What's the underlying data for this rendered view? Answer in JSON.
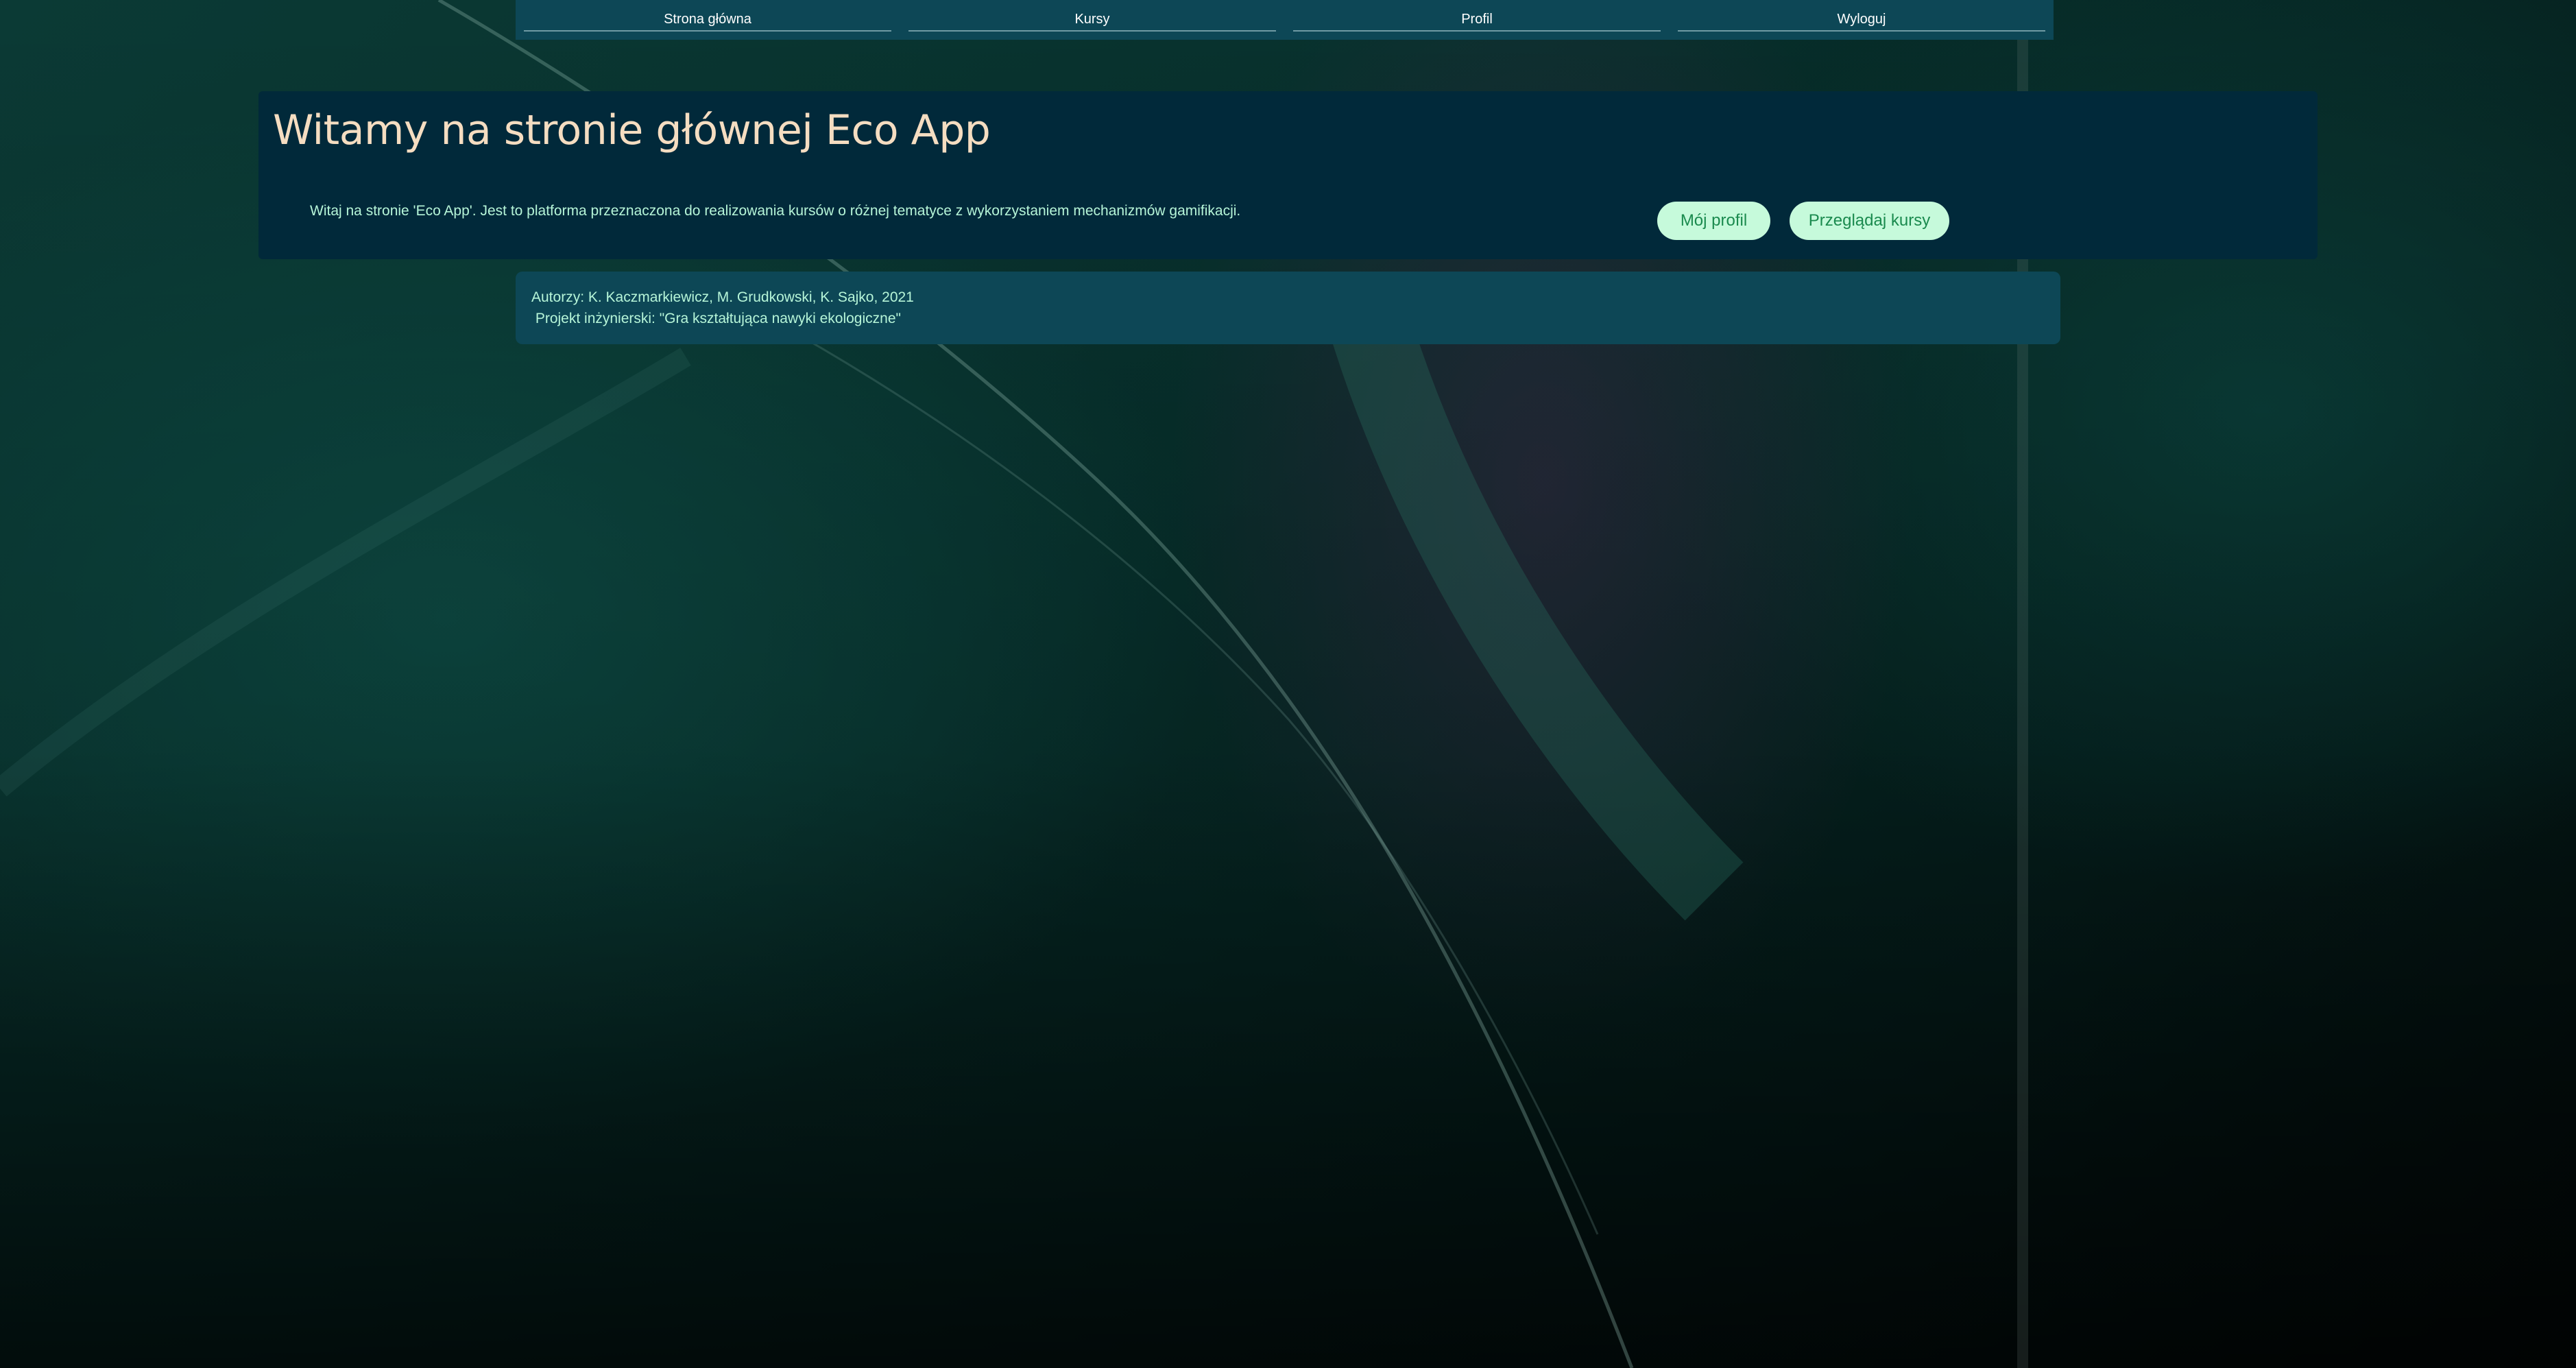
{
  "nav": {
    "items": [
      {
        "label": "Strona główna"
      },
      {
        "label": "Kursy"
      },
      {
        "label": "Profil"
      },
      {
        "label": "Wyloguj"
      }
    ]
  },
  "hero": {
    "title": "Witamy na stronie głównej Eco App",
    "description": "Witaj na stronie 'Eco App'. Jest to platforma przeznaczona do realizowania kursów o różnej tematyce z wykorzystaniem mechanizmów gamifikacji.",
    "buttons": {
      "profile": "Mój profil",
      "courses": "Przeglądaj kursy"
    }
  },
  "info": {
    "authors": "Autorzy: K. Kaczmarkiewicz, M. Grudkowski, K. Sajko, 2021",
    "project": " Projekt inżynierski: \"Gra kształtująca nawyki ekologiczne\""
  },
  "colors": {
    "nav_bg": "#0d4756",
    "hero_bg": "#01293a",
    "title": "#f5ddc1",
    "text": "#b6f5d8",
    "button_bg": "#c6fadb",
    "button_text": "#1a8a4e"
  }
}
